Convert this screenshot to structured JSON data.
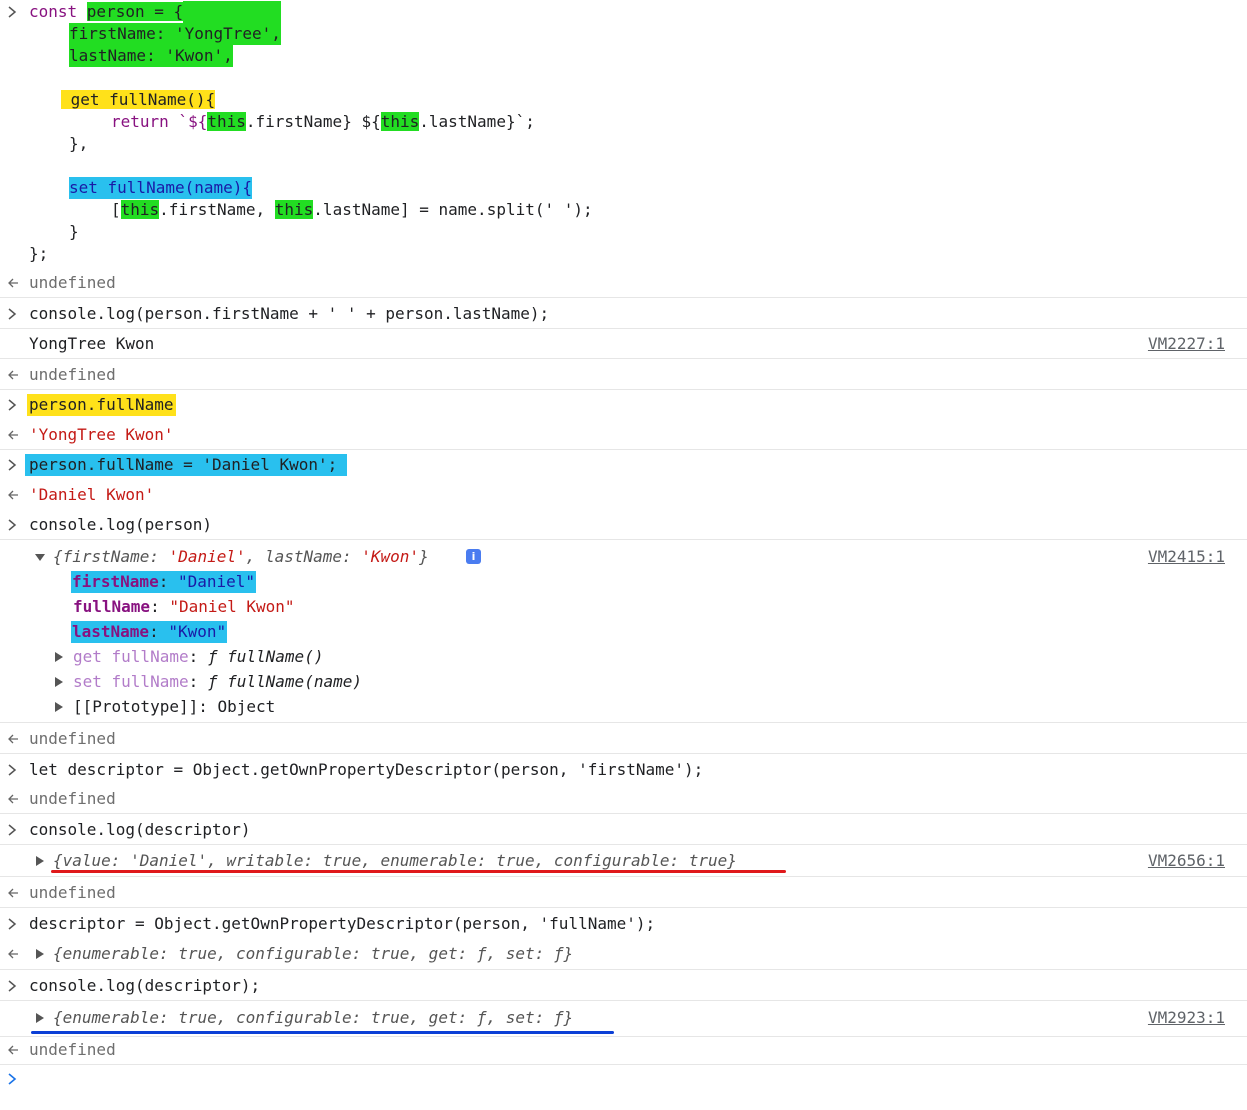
{
  "code_block": {
    "l1a": "const ",
    "l1b": "person = {",
    "l2": "firstName: 'YongTree',",
    "l3": "lastName: 'Kwon',",
    "l4": "get fullName(){",
    "l5a": "return `${",
    "l5b": "this",
    "l5c": ".firstName} ${",
    "l5d": "this",
    "l5e": ".lastName}`;",
    "l6": "},",
    "l7": "set fullName(name){",
    "l8a": "[",
    "l8b": "this",
    "l8c": ".firstName, ",
    "l8d": "this",
    "l8e": ".lastName] = name.split(' ');",
    "l9": "}",
    "l10": "};"
  },
  "entries": {
    "undefined": "undefined",
    "log1_input": "console.log(person.firstName + ' ' + person.lastName);",
    "log1_output": "YongTree Kwon",
    "log1_source": "VM2227:1",
    "getter_input": "person.fullName",
    "getter_result": "'YongTree Kwon'",
    "setter_input": "person.fullName = 'Daniel Kwon';",
    "setter_result": "'Daniel Kwon'",
    "log2_input": "console.log(person)",
    "log2_source": "VM2415:1",
    "log2_summary": "{firstName: 'Daniel', lastName: 'Kwon'}",
    "obj_firstName_key": "firstName",
    "obj_firstName_val": "\"Daniel\"",
    "obj_fullName_key": "fullName",
    "obj_fullName_val": "\"Daniel Kwon\"",
    "obj_lastName_key": "lastName",
    "obj_lastName_val": "\"Kwon\"",
    "obj_get": "get fullName",
    "obj_get_val": "ƒ fullName()",
    "obj_set": "set fullName",
    "obj_set_val": "ƒ fullName(name)",
    "obj_proto": "[[Prototype]]: Object",
    "descriptor_input": "let descriptor = Object.getOwnPropertyDescriptor(person, 'firstName');",
    "log3_input": "console.log(descriptor)",
    "log3_source": "VM2656:1",
    "log3_output": "{value: 'Daniel', writable: true, enumerable: true, configurable: true}",
    "descriptor2_input": "descriptor = Object.getOwnPropertyDescriptor(person, 'fullName');",
    "descriptor2_result": "{enumerable: true, configurable: true, get: ƒ, set: ƒ}",
    "log4_input": "console.log(descriptor);",
    "log4_source": "VM2923:1",
    "log4_output": "{enumerable: true, configurable: true, get: ƒ, set: ƒ}"
  },
  "colors": {
    "highlight_green": "#22dd22",
    "highlight_yellow": "#ffe11a",
    "highlight_blue": "#29c0ee",
    "underline_red": "#e0191b",
    "underline_blue": "#0b3fd6",
    "prompt_arrow": "#1a73e8"
  }
}
